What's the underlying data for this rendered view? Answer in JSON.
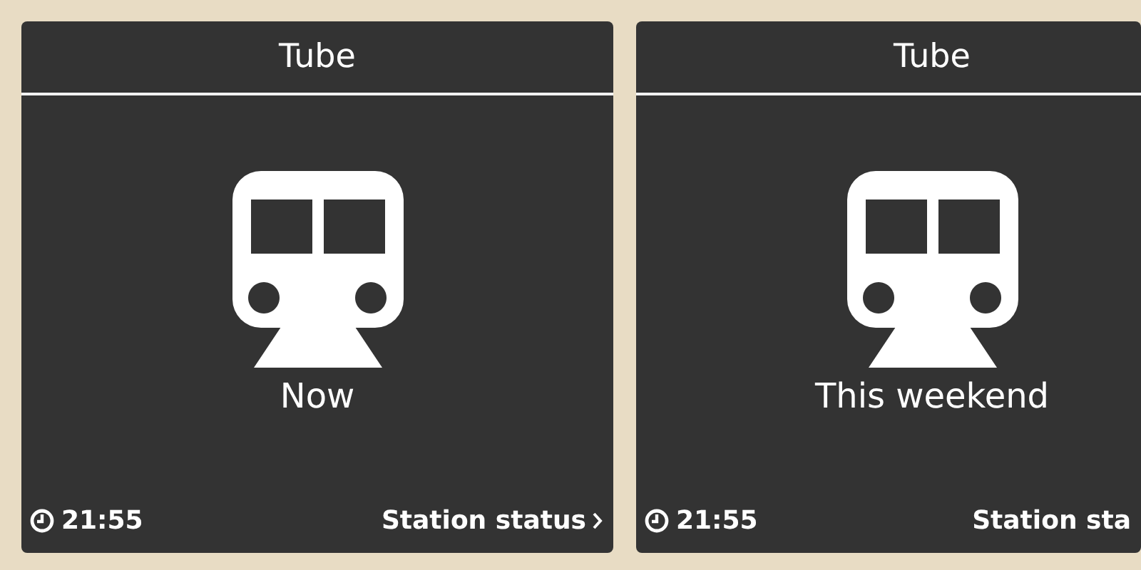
{
  "cards": [
    {
      "title": "Tube",
      "label": "Now",
      "time": "21:55",
      "link": "Station status",
      "chevron": true
    },
    {
      "title": "Tube",
      "label": "This weekend",
      "time": "21:55",
      "link": "Station sta",
      "chevron": false
    }
  ]
}
